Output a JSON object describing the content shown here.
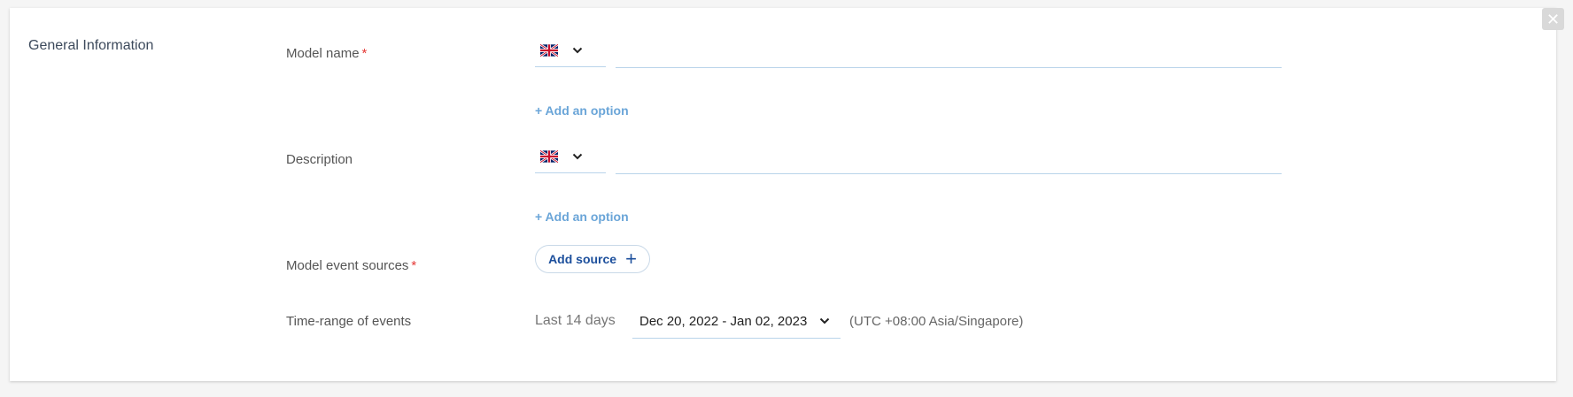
{
  "panel": {
    "close_symbol": "✕",
    "section_title": "General Information"
  },
  "fields": {
    "model_name": {
      "label": "Model name",
      "required_mark": "*",
      "language_icon": "uk-flag-icon",
      "value": "",
      "add_option": "+ Add an option"
    },
    "description": {
      "label": "Description",
      "language_icon": "uk-flag-icon",
      "value": "",
      "add_option": "+ Add an option"
    },
    "event_sources": {
      "label": "Model event sources",
      "required_mark": "*",
      "button_label": "Add source",
      "button_icon": "+"
    },
    "time_range": {
      "label": "Time-range of events",
      "preset": "Last 14 days",
      "selected_range": "Dec 20, 2022 - Jan 02, 2023",
      "timezone": "(UTC +08:00 Asia/Singapore)"
    }
  },
  "colors": {
    "required": "#e53935",
    "link": "#6aa5d8",
    "button_text": "#1c4f9c",
    "input_underline": "#b9d4ea"
  }
}
